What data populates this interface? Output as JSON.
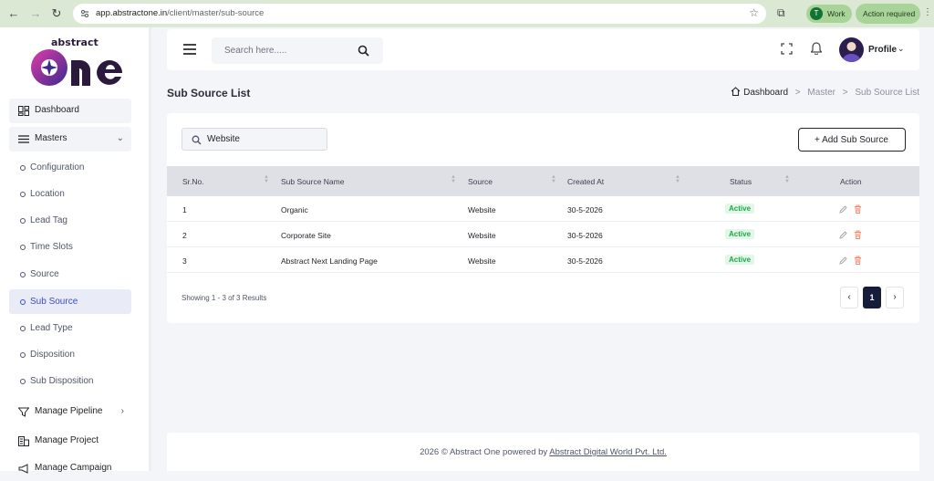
{
  "browser": {
    "url_host": "app.abstractone.in",
    "url_path": "/client/master/sub-source",
    "profile_initial": "T",
    "profile_label": "Work",
    "action_label": "Action required"
  },
  "sidebar": {
    "logo_text": "abstract",
    "logo_big": "one",
    "items": [
      {
        "label": "Dashboard"
      },
      {
        "label": "Masters"
      },
      {
        "label": "Configuration"
      },
      {
        "label": "Location"
      },
      {
        "label": "Lead Tag"
      },
      {
        "label": "Time Slots"
      },
      {
        "label": "Source"
      },
      {
        "label": "Sub Source"
      },
      {
        "label": "Lead Type"
      },
      {
        "label": "Disposition"
      },
      {
        "label": "Sub Disposition"
      },
      {
        "label": "Manage Pipeline"
      },
      {
        "label": "Manage Project"
      },
      {
        "label": "Manage Campaign"
      }
    ]
  },
  "header": {
    "search_placeholder": "Search here.....",
    "profile_label": "Profile"
  },
  "page": {
    "title": "Sub Source List",
    "breadcrumb": [
      "Dashboard",
      "Master",
      "Sub Source List"
    ]
  },
  "card": {
    "filter_value": "Website",
    "add_button": "+ Add Sub Source",
    "columns": [
      "Sr.No.",
      "Sub Source Name",
      "Source",
      "Created At",
      "Status",
      "Action"
    ],
    "rows": [
      {
        "sr": "1",
        "name": "Organic",
        "source": "Website",
        "created": "30-5-2026",
        "status": "Active"
      },
      {
        "sr": "2",
        "name": "Corporate Site",
        "source": "Website",
        "created": "30-5-2026",
        "status": "Active"
      },
      {
        "sr": "3",
        "name": "Abstract Next Landing Page",
        "source": "Website",
        "created": "30-5-2026",
        "status": "Active"
      }
    ],
    "results_text": "Showing 1 - 3 of 3 Results",
    "pagination": {
      "prev": "‹",
      "current": "1",
      "next": "›"
    }
  },
  "footer": {
    "text": "2026 © Abstract One powered by ",
    "link": "Abstract Digital World Pvt. Ltd."
  },
  "colors": {
    "accent": "#3b4fbf",
    "active_badge": "#1ea94a",
    "pagination_active": "#161d3a"
  }
}
